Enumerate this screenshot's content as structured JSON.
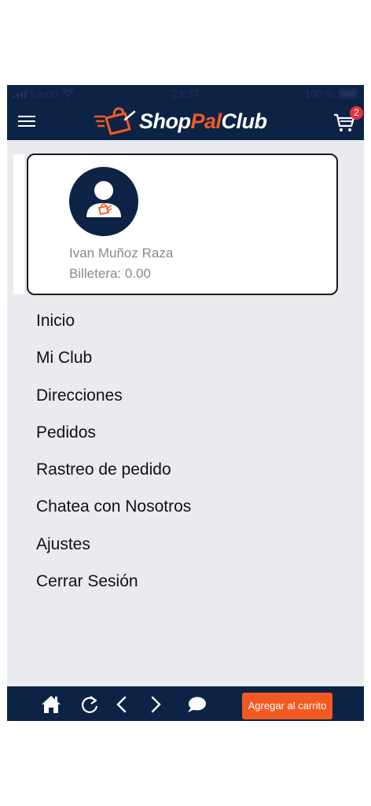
{
  "status_bar": {
    "carrier": "tuenti",
    "time": "23:37",
    "battery": "100 %"
  },
  "header": {
    "logo_shop": "Shop",
    "logo_pal": "Pal",
    "logo_club": "Club",
    "cart_count": "2"
  },
  "profile": {
    "name": "Ivan Muñoz Raza",
    "wallet": "Billetera: 0.00"
  },
  "menu": {
    "items": [
      {
        "label": "Inicio"
      },
      {
        "label": "Mi Club"
      },
      {
        "label": "Direcciones"
      },
      {
        "label": "Pedidos"
      },
      {
        "label": "Rastreo de pedido"
      },
      {
        "label": "Chatea con Nosotros"
      },
      {
        "label": "Ajustes"
      },
      {
        "label": "Cerrar Sesión"
      }
    ]
  },
  "bottom_bar": {
    "add_to_cart_label": "Agregar al carrito",
    "icons": [
      "home-icon",
      "reload-icon",
      "back-icon",
      "forward-icon",
      "chat-icon"
    ]
  },
  "colors": {
    "navy": "#0c2346",
    "orange": "#f15a22",
    "badge": "#e8323c",
    "background": "#e9ebee"
  }
}
